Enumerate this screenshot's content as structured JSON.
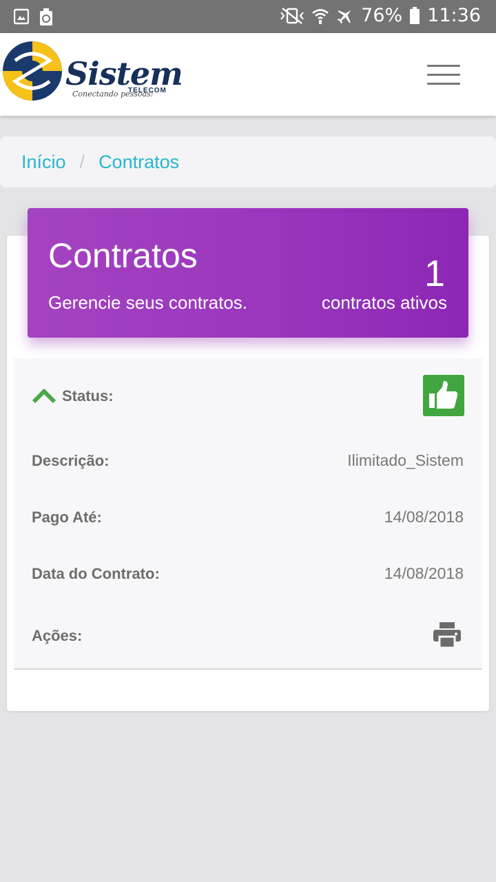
{
  "status_bar": {
    "battery": "76%",
    "time": "11:36",
    "left_icons": [
      "gallery-icon",
      "recycle-icon"
    ],
    "right_icons": [
      "vibrate-icon",
      "wifi-icon",
      "airplane-icon",
      "battery-icon"
    ]
  },
  "header": {
    "logo_text": "Sistem",
    "logo_tagline": "Conectando pessoas!",
    "logo_subtext": "TELECOM",
    "menu_icon": "hamburger-menu-icon"
  },
  "breadcrumb": {
    "items": [
      "Início",
      "Contratos"
    ],
    "separator": "/"
  },
  "banner": {
    "title": "Contratos",
    "subtitle": "Gerencie seus contratos.",
    "count": "1",
    "count_label": "contratos ativos",
    "color": "#9a36bd"
  },
  "contract": {
    "status_label": "Status:",
    "status_icon": "thumbs-up-icon",
    "status_color": "#41a63f",
    "rows": [
      {
        "label": "Descrição:",
        "value": "Ilimitado_Sistem"
      },
      {
        "label": "Pago Até:",
        "value": "14/08/2018"
      },
      {
        "label": "Data do Contrato:",
        "value": "14/08/2018"
      }
    ],
    "actions_label": "Ações:",
    "actions_icon": "print-icon"
  }
}
